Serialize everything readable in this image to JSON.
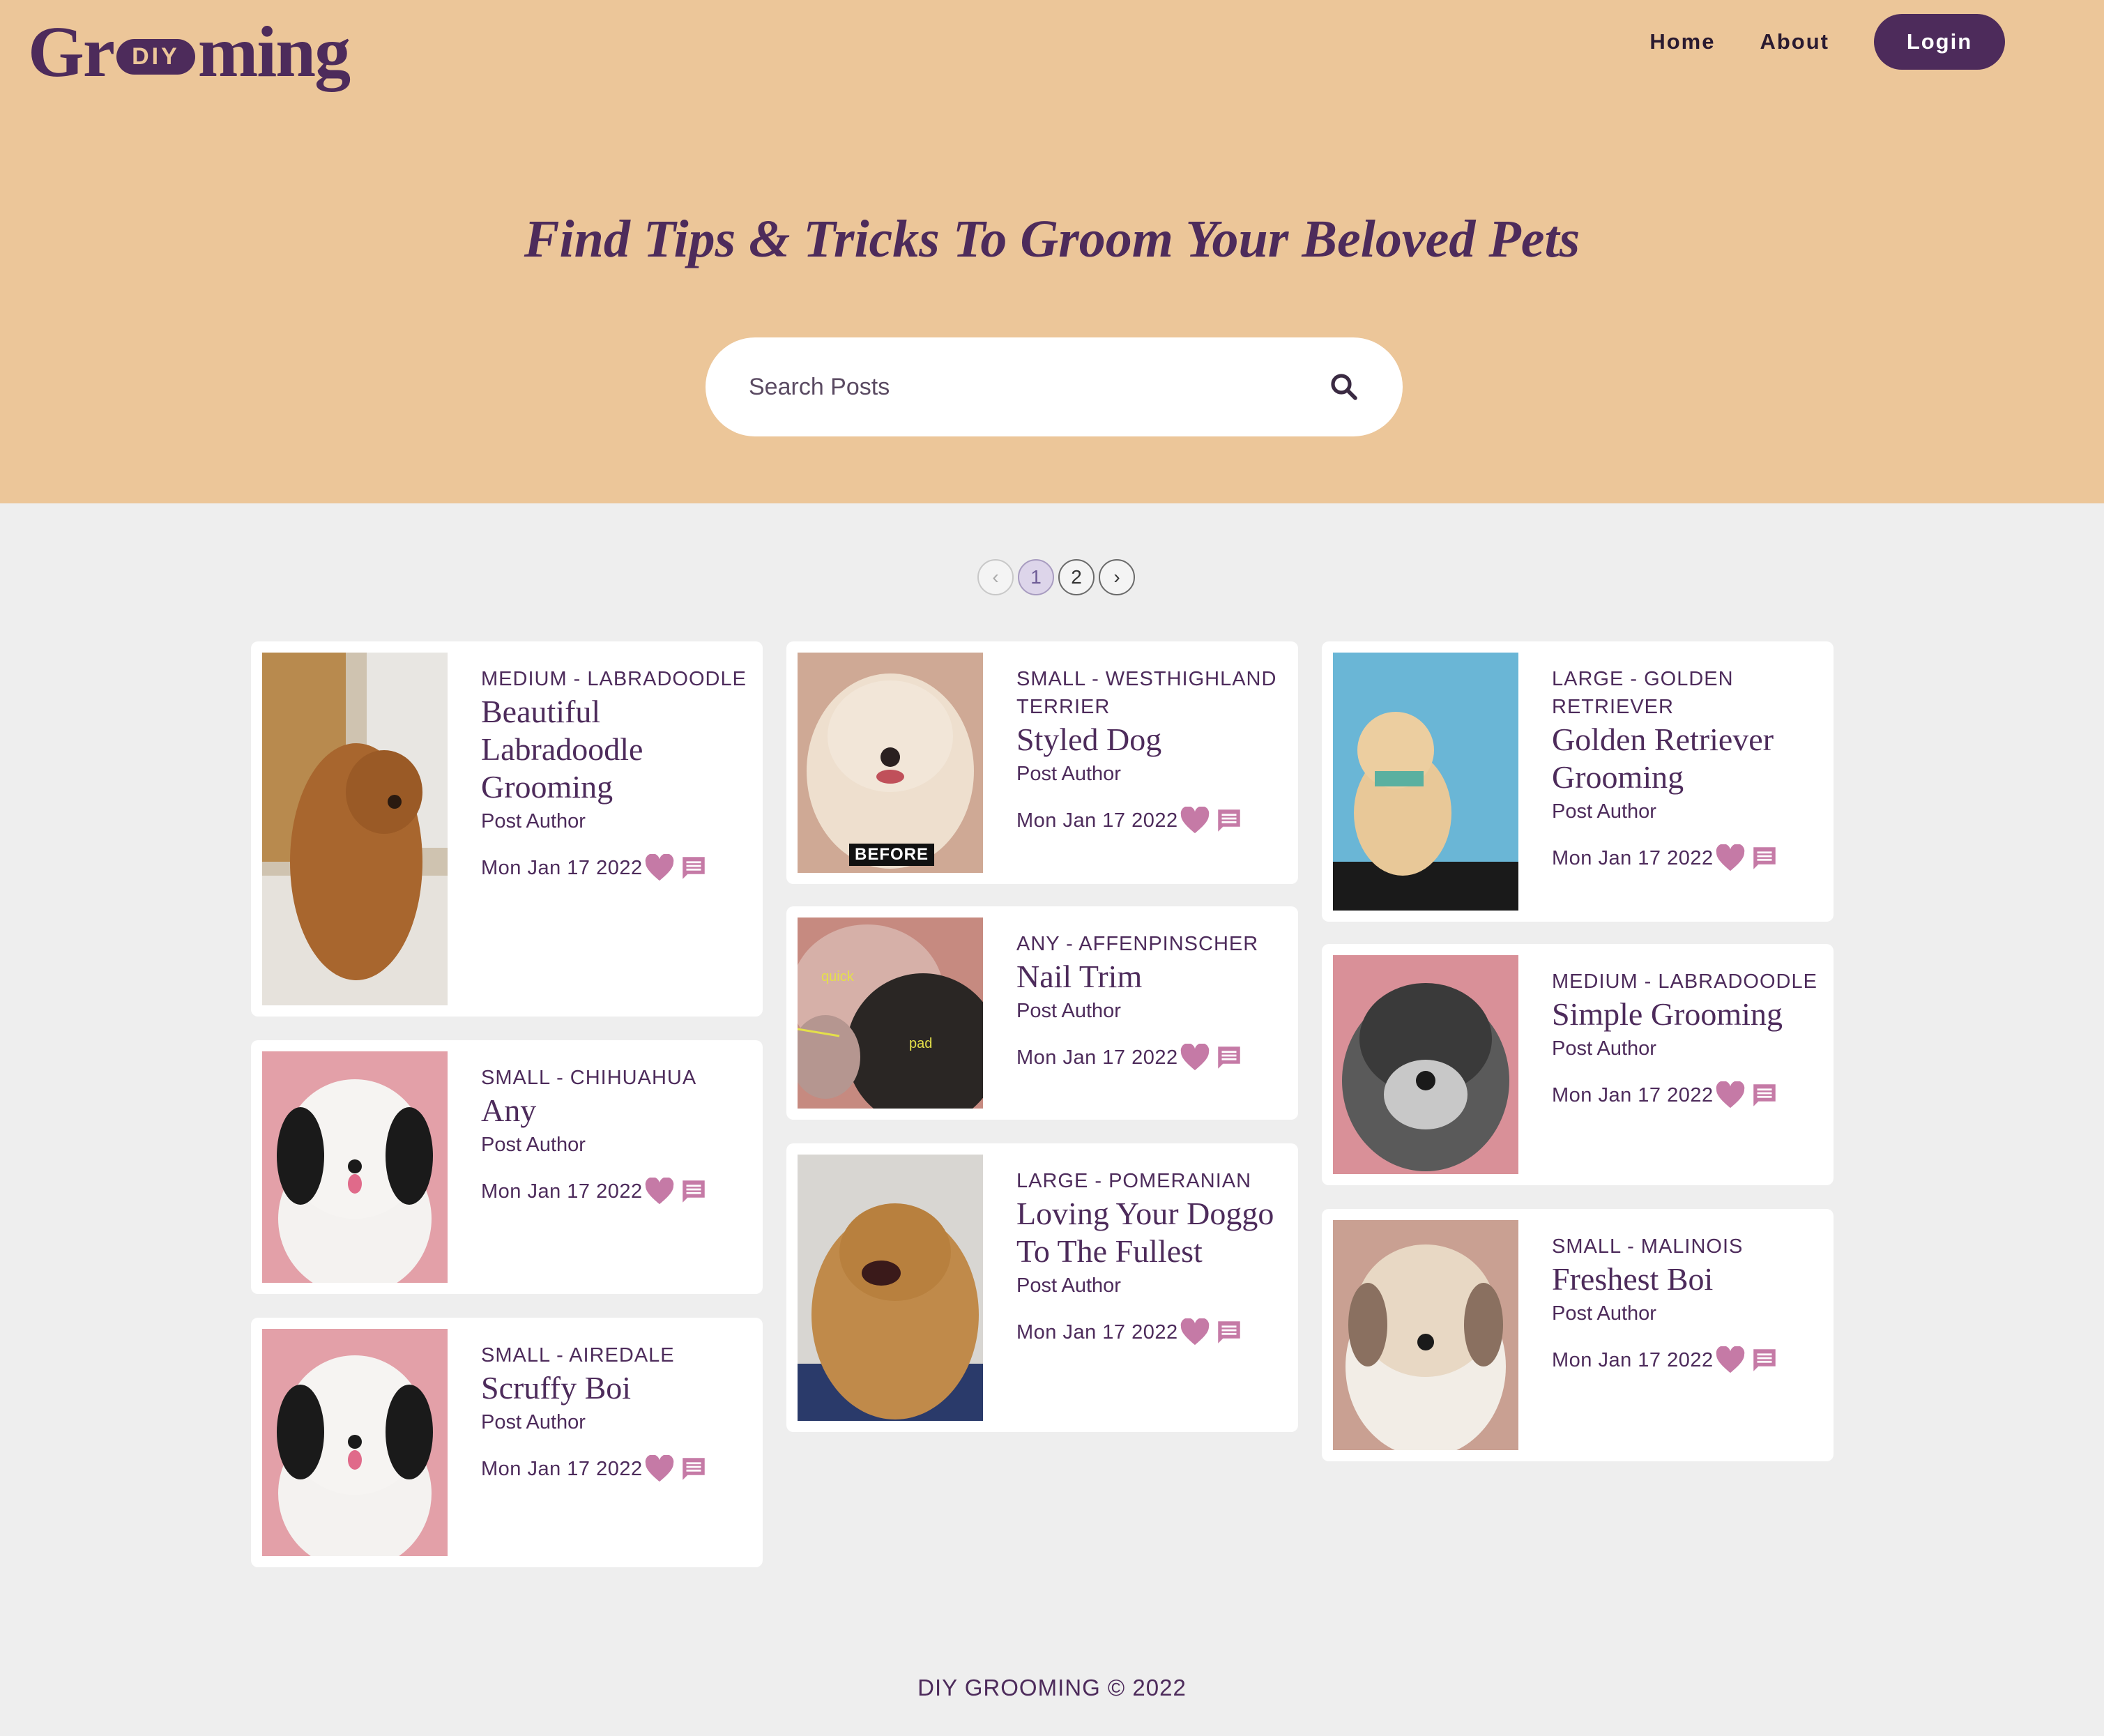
{
  "header": {
    "logo_text_left": "Gr",
    "logo_badge": "DIY",
    "logo_text_right": "ming",
    "nav": {
      "home": "Home",
      "about": "About",
      "login": "Login"
    }
  },
  "hero": {
    "title": "Find Tips & Tricks To Groom Your Beloved Pets",
    "search_placeholder": "Search Posts"
  },
  "pagination": {
    "prev": "‹",
    "pages": [
      "1",
      "2"
    ],
    "current": "1",
    "next": "›"
  },
  "colors": {
    "brand": "#4d2b5b",
    "hero_bg": "#ecc699",
    "accent_pink": "#c57aa6",
    "page_bg": "#eeeeee"
  },
  "posts": [
    {
      "category": "MEDIUM - LABRADOODLE",
      "title": "Beautiful Labradoodle Grooming",
      "author": "Post Author",
      "date": "Mon Jan 17 2022"
    },
    {
      "category": "SMALL - CHIHUAHUA",
      "title": "Any",
      "author": "Post Author",
      "date": "Mon Jan 17 2022"
    },
    {
      "category": "SMALL - AIREDALE",
      "title": "Scruffy Boi",
      "author": "Post Author",
      "date": "Mon Jan 17 2022"
    },
    {
      "category": "SMALL - WESTHIGHLAND TERRIER",
      "title": "Styled Dog",
      "author": "Post Author",
      "date": "Mon Jan 17 2022",
      "image_label": "BEFORE"
    },
    {
      "category": "ANY - AFFENPINSCHER",
      "title": "Nail Trim",
      "author": "Post Author",
      "date": "Mon Jan 17 2022",
      "image_labels": [
        "quick",
        "pad"
      ]
    },
    {
      "category": "LARGE - POMERANIAN",
      "title": "Loving Your Doggo To The Fullest",
      "author": "Post Author",
      "date": "Mon Jan 17 2022"
    },
    {
      "category": "LARGE - GOLDEN RETRIEVER",
      "title": "Golden Retriever Grooming",
      "author": "Post Author",
      "date": "Mon Jan 17 2022"
    },
    {
      "category": "MEDIUM - LABRADOODLE",
      "title": "Simple Grooming",
      "author": "Post Author",
      "date": "Mon Jan 17 2022"
    },
    {
      "category": "SMALL - MALINOIS",
      "title": "Freshest Boi",
      "author": "Post Author",
      "date": "Mon Jan 17 2022"
    }
  ],
  "footer": {
    "text": "DIY GROOMING © 2022"
  }
}
